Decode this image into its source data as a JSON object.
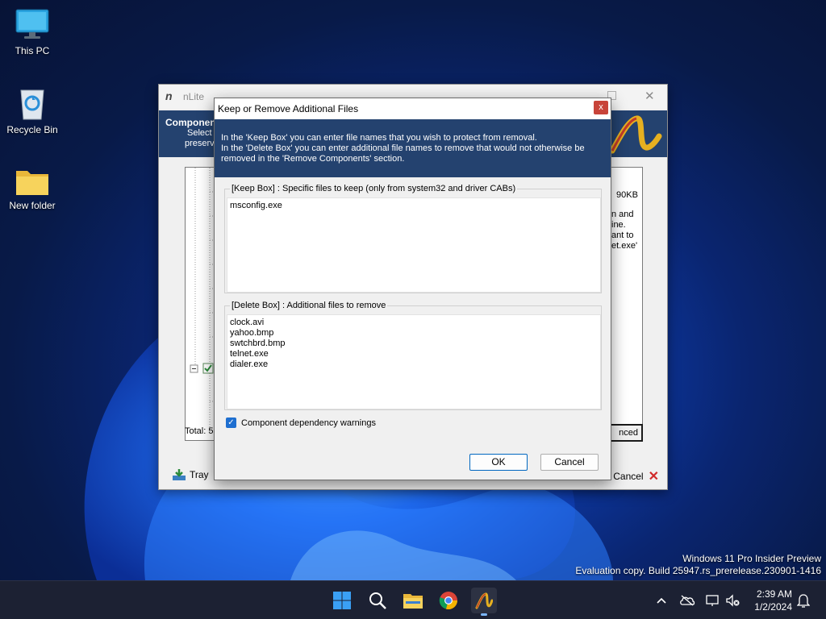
{
  "desktop": {
    "icons": [
      {
        "label": "This PC"
      },
      {
        "label": "Recycle Bin"
      },
      {
        "label": "New folder"
      }
    ],
    "watermark_line1": "Windows 11 Pro Insider Preview",
    "watermark_line2": "Evaluation copy. Build 25947.rs_prerelease.230901-1416"
  },
  "taskbar": {
    "icons": [
      "start-icon",
      "search-icon",
      "file-explorer-icon",
      "chrome-icon",
      "nlite-icon"
    ],
    "clock_time": "2:39 AM",
    "clock_date": "1/2/2024"
  },
  "nlite_window": {
    "title": "nLite",
    "header_title": "Component",
    "header_sub_line1": "Select t",
    "header_sub_line2": "preserv",
    "size_fragment": "90KB",
    "desc_fragments": [
      "n and",
      "ine.",
      "ant to",
      "et.exe'"
    ],
    "total_label": "Total: 5",
    "advanced_fragment": "nced",
    "tray_label": "Tray",
    "cancel_label": "Cancel"
  },
  "dialog": {
    "title": "Keep or Remove Additional Files",
    "close_glyph": "x",
    "banner_line1": "In the 'Keep Box' you can enter file names that you wish to protect from removal.",
    "banner_line2": "In the 'Delete Box' you can enter additional file names to remove that would not otherwise be",
    "banner_line3": "removed in the 'Remove Components' section.",
    "keep_box": {
      "legend": "[Keep Box] : Specific files to keep (only from system32 and driver CABs)",
      "lines": [
        "msconfig.exe"
      ]
    },
    "delete_box": {
      "legend": "[Delete Box] : Additional files to remove",
      "lines": [
        "clock.avi",
        "yahoo.bmp",
        "swtchbrd.bmp",
        "telnet.exe",
        "dialer.exe"
      ]
    },
    "dependency_checkbox_label": "Component dependency warnings",
    "dependency_checked": true,
    "ok_label": "OK",
    "cancel_label": "Cancel"
  },
  "colors": {
    "banner_blue": "#24426f",
    "accent_blue": "#1e6fd0",
    "taskbar_bg": "#1c2133"
  }
}
